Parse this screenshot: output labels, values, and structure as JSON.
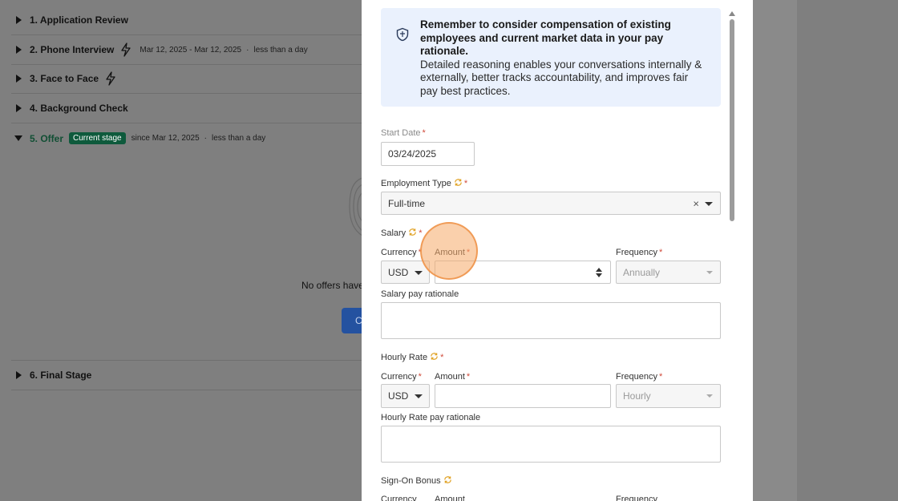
{
  "stages": [
    {
      "label": "1. Application Review",
      "meta_dates": "",
      "meta_duration": "",
      "badge": ""
    },
    {
      "label": "2. Phone Interview",
      "meta_dates": "Mar 12, 2025 - Mar 12, 2025",
      "meta_duration": "less than a day",
      "badge": ""
    },
    {
      "label": "3. Face to Face",
      "meta_dates": "",
      "meta_duration": "",
      "badge": ""
    },
    {
      "label": "4. Background Check",
      "meta_dates": "",
      "meta_duration": "",
      "badge": ""
    },
    {
      "label": "5. Offer",
      "meta_dates": "since Mar 12, 2025",
      "meta_duration": "less than a day",
      "badge": "Current stage"
    },
    {
      "label": "6. Final Stage",
      "meta_dates": "",
      "meta_duration": "",
      "badge": ""
    }
  ],
  "offer_panel": {
    "no_offers_text": "No offers have",
    "create_button_partial": "C"
  },
  "callout": {
    "title": "Remember to consider compensation of existing employees and current market data in your pay rationale.",
    "body": "Detailed reasoning enables your conversations internally & externally, better tracks accountability, and improves fair pay best practices."
  },
  "form": {
    "start_date": {
      "label": "Start Date",
      "value": "03/24/2025"
    },
    "employment_type": {
      "label": "Employment Type",
      "value": "Full-time",
      "clear": "×"
    },
    "salary": {
      "label": "Salary",
      "currency_label": "Currency",
      "currency_value": "USD",
      "amount_label": "Amount",
      "amount_value": "",
      "frequency_label": "Frequency",
      "frequency_value": "Annually",
      "rationale_label": "Salary pay rationale"
    },
    "hourly": {
      "label": "Hourly Rate",
      "currency_label": "Currency",
      "currency_value": "USD",
      "amount_label": "Amount",
      "amount_value": "",
      "frequency_label": "Frequency",
      "frequency_value": "Hourly",
      "rationale_label": "Hourly Rate pay rationale"
    },
    "signon": {
      "label": "Sign-On Bonus",
      "currency_label": "Currency",
      "amount_label": "Amount",
      "frequency_label": "Frequency"
    },
    "required_mark": "*"
  },
  "colors": {
    "badge_bg": "#0e5a3c",
    "callout_bg": "#eaf1fd",
    "required": "#d04a3a",
    "sync_icon": "#e0a020",
    "click_highlight": "#f6a968"
  },
  "icons": {
    "stage_caret": "caret-right-icon",
    "bolt": "lightning-bolt-icon",
    "callout": "shield-icon",
    "sync": "sync-icon"
  }
}
